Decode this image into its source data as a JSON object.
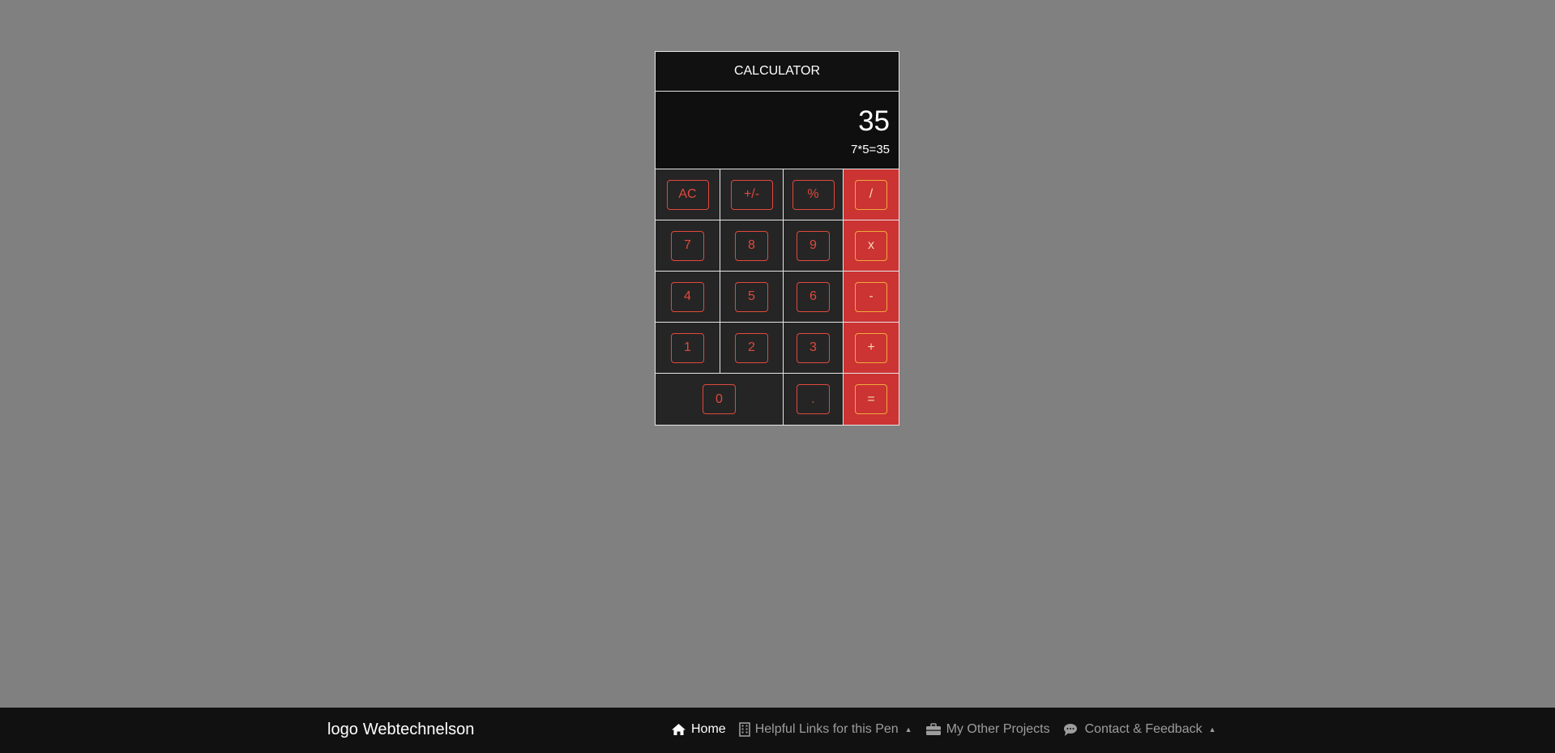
{
  "calculator": {
    "title": "CALCULATOR",
    "result": "35",
    "expression": "7*5=35",
    "rows": [
      [
        {
          "label": "AC",
          "type": "fn"
        },
        {
          "label": "+/-",
          "type": "fn"
        },
        {
          "label": "%",
          "type": "fn"
        },
        {
          "label": "/",
          "type": "op"
        }
      ],
      [
        {
          "label": "7",
          "type": "num"
        },
        {
          "label": "8",
          "type": "num"
        },
        {
          "label": "9",
          "type": "num"
        },
        {
          "label": "x",
          "type": "op"
        }
      ],
      [
        {
          "label": "4",
          "type": "num"
        },
        {
          "label": "5",
          "type": "num"
        },
        {
          "label": "6",
          "type": "num"
        },
        {
          "label": "-",
          "type": "op"
        }
      ],
      [
        {
          "label": "1",
          "type": "num"
        },
        {
          "label": "2",
          "type": "num"
        },
        {
          "label": "3",
          "type": "num"
        },
        {
          "label": "+",
          "type": "op"
        }
      ],
      [
        {
          "label": "0",
          "type": "num"
        },
        {
          "label": ".",
          "type": "num"
        },
        {
          "label": "=",
          "type": "op"
        }
      ]
    ]
  },
  "footer": {
    "logo_text": "logo",
    "brand": "Webtechnelson",
    "nav": [
      {
        "label": "Home",
        "icon": "home-icon",
        "active": true,
        "caret": false
      },
      {
        "label": "Helpful Links for this Pen",
        "icon": "building-icon",
        "active": false,
        "caret": true
      },
      {
        "label": "My Other Projects",
        "icon": "briefcase-icon",
        "active": false,
        "caret": false
      },
      {
        "label": "Contact & Feedback",
        "icon": "chat-bubbles-icon",
        "active": false,
        "caret": true
      }
    ]
  },
  "colors": {
    "background": "#808080",
    "accent_red": "#cc3333",
    "button_text": "#e0493d",
    "operator_border": "#f0a93c"
  }
}
